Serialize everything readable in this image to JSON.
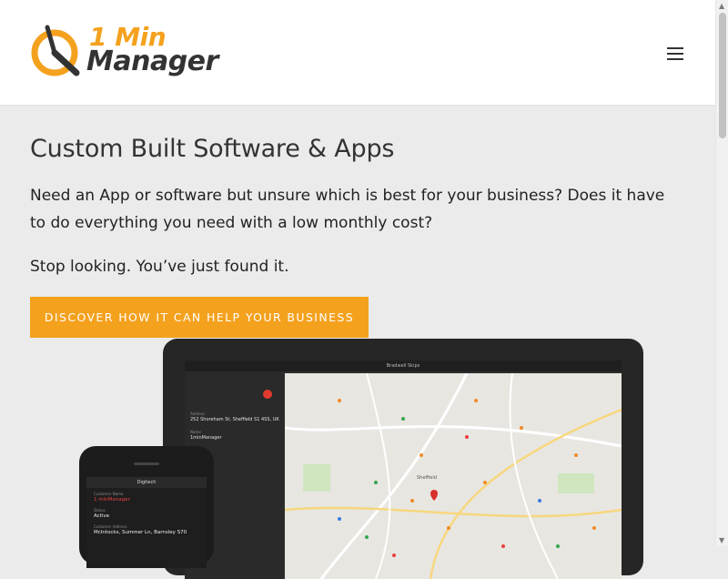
{
  "header": {
    "logo": {
      "line1": "1 Min",
      "line2": "Manager"
    },
    "menu_icon": "hamburger-menu-icon"
  },
  "hero": {
    "title": "Custom Built Software & Apps",
    "text": "Need an App or software but unsure which is best for your business? Does it have to do everything you need with a low monthly cost?",
    "subtext": "Stop looking. You’ve just found it.",
    "cta_label": "DISCOVER HOW IT CAN HELP YOUR BUSINESS"
  },
  "tablet": {
    "title": "Bradwell Skips",
    "fields": [
      {
        "label": "Address",
        "value": "252 Shoreham St, Sheffield S1 4SS, UK"
      },
      {
        "label": "Name",
        "value": "1minManager"
      }
    ],
    "map_label": "Sheffield"
  },
  "phone": {
    "app_name": "Digitech",
    "fields": [
      {
        "label": "Customer Name",
        "value": "1 minManager"
      },
      {
        "label": "Status",
        "value": "Active"
      },
      {
        "label": "Customer Address",
        "value": "McIntocks, Summer Ln, Barnsley S70"
      }
    ]
  },
  "colors": {
    "accent": "#f4a11e",
    "header_bg": "#ffffff",
    "page_bg": "#ebebeb",
    "text": "#333333",
    "device": "#262626"
  }
}
